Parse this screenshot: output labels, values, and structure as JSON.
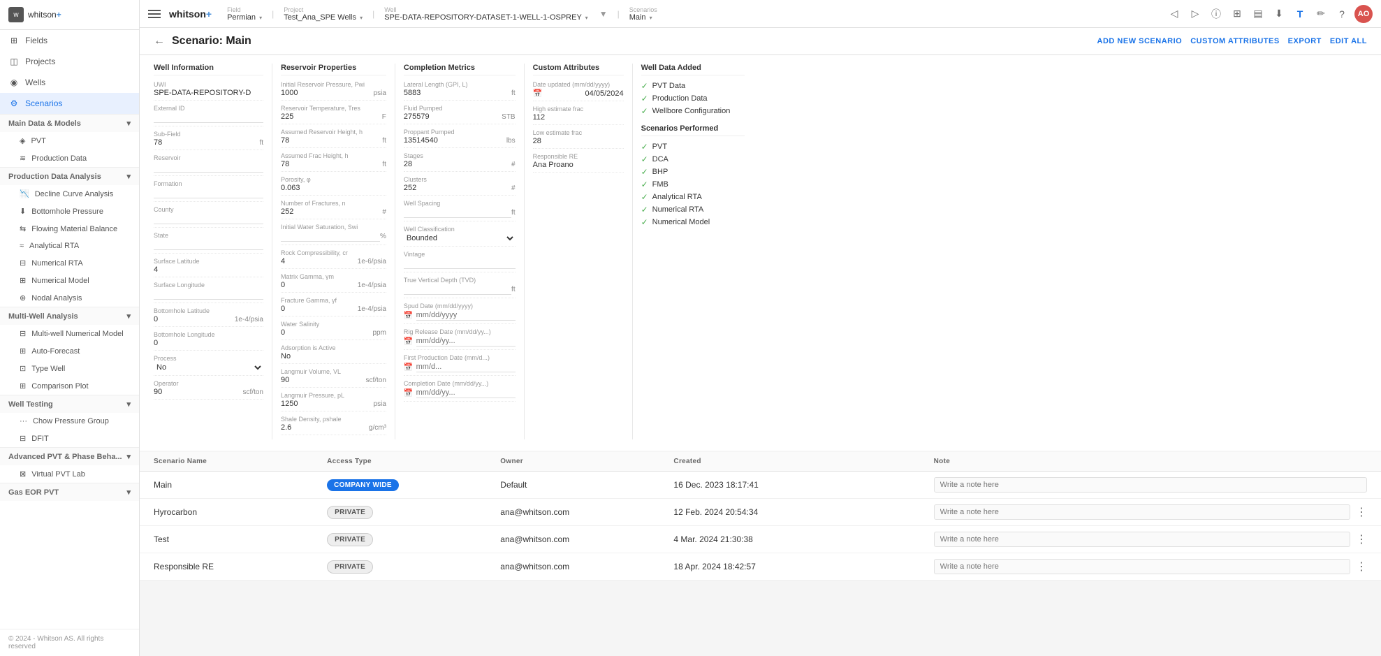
{
  "sidebar": {
    "logo": "whitson",
    "logo_plus": "+",
    "nav": [
      {
        "id": "fields",
        "label": "Fields",
        "icon": "⊞"
      },
      {
        "id": "projects",
        "label": "Projects",
        "icon": "📁"
      },
      {
        "id": "wells",
        "label": "Wells",
        "icon": "◎"
      },
      {
        "id": "scenarios",
        "label": "Scenarios",
        "icon": "⚙",
        "active": true
      }
    ],
    "sections": [
      {
        "id": "main-data",
        "label": "Main Data & Models",
        "expanded": true,
        "items": [
          {
            "id": "pvt",
            "label": "PVT"
          },
          {
            "id": "production-data",
            "label": "Production Data"
          }
        ]
      },
      {
        "id": "production-analysis",
        "label": "Production Data Analysis",
        "expanded": true,
        "items": [
          {
            "id": "decline-curve",
            "label": "Decline Curve Analysis"
          },
          {
            "id": "bottomhole-pressure",
            "label": "Bottomhole Pressure"
          },
          {
            "id": "flowing-material",
            "label": "Flowing Material Balance"
          },
          {
            "id": "analytical-rta",
            "label": "Analytical RTA"
          },
          {
            "id": "numerical-rta",
            "label": "Numerical RTA"
          },
          {
            "id": "numerical-model",
            "label": "Numerical Model"
          },
          {
            "id": "nodal-analysis",
            "label": "Nodal Analysis"
          }
        ]
      },
      {
        "id": "multi-well",
        "label": "Multi-Well Analysis",
        "expanded": true,
        "items": [
          {
            "id": "multi-well-numerical",
            "label": "Multi-well Numerical Model"
          },
          {
            "id": "auto-forecast",
            "label": "Auto-Forecast"
          },
          {
            "id": "type-well",
            "label": "Type Well"
          },
          {
            "id": "comparison-plot",
            "label": "Comparison Plot"
          }
        ]
      },
      {
        "id": "well-testing",
        "label": "Well Testing",
        "expanded": true,
        "items": [
          {
            "id": "chow-pressure",
            "label": "Chow Pressure Group"
          },
          {
            "id": "dfit",
            "label": "DFIT"
          }
        ]
      },
      {
        "id": "advanced-pvt",
        "label": "Advanced PVT & Phase Beha...",
        "expanded": false,
        "items": [
          {
            "id": "virtual-pvt",
            "label": "Virtual PVT Lab"
          }
        ]
      },
      {
        "id": "gas-eor",
        "label": "Gas EOR PVT",
        "expanded": false,
        "items": []
      }
    ],
    "footer": "© 2024 - Whitson AS. All rights reserved"
  },
  "topbar": {
    "field_label": "Field",
    "field_value": "Permian",
    "project_label": "Project",
    "project_value": "Test_Ana_SPE Wells",
    "well_label": "Well",
    "well_value": "SPE-DATA-REPOSITORY-DATASET-1-WELL-1-OSPREY",
    "scenarios_label": "Scenarios",
    "scenarios_value": "Main",
    "filter_icon": "▼"
  },
  "page": {
    "back_label": "←",
    "title": "Scenario: Main",
    "actions": {
      "add_new_scenario": "ADD NEW SCENARIO",
      "custom_attributes": "CUSTOM ATTRIBUTES",
      "export": "EXPORT",
      "edit_all": "EDIT ALL"
    }
  },
  "well_information": {
    "title": "Well Information",
    "fields": [
      {
        "label": "UWI",
        "value": "SPE-DATA-REPOSITORY-D",
        "unit": ""
      },
      {
        "label": "External ID",
        "value": "",
        "unit": ""
      },
      {
        "label": "Sub-Field",
        "value": "78",
        "unit": "ft"
      },
      {
        "label": "Reservoir",
        "value": "",
        "unit": ""
      },
      {
        "label": "Formation",
        "value": "",
        "unit": ""
      },
      {
        "label": "County",
        "value": "",
        "unit": ""
      },
      {
        "label": "State",
        "value": "",
        "unit": ""
      },
      {
        "label": "Surface Latitude",
        "value": "4",
        "unit": ""
      },
      {
        "label": "Surface Longitude",
        "value": "",
        "unit": ""
      },
      {
        "label": "Bottomhole Latitude",
        "value": "0",
        "unit": "1e-4/psia"
      },
      {
        "label": "Bottomhole Longitude",
        "value": "0",
        "unit": ""
      },
      {
        "label": "Process",
        "value": "No",
        "unit": "",
        "type": "select"
      },
      {
        "label": "Operator",
        "value": "90",
        "unit": "scf/ton"
      }
    ]
  },
  "reservoir_properties": {
    "title": "Reservoir Properties",
    "fields": [
      {
        "label": "Initial Reservoir Pressure, Pwi",
        "value": "1000",
        "unit": "psia"
      },
      {
        "label": "Reservoir Temperature, Tres",
        "value": "225",
        "unit": "F"
      },
      {
        "label": "Assumed Reservoir Height, h",
        "value": "78",
        "unit": "ft"
      },
      {
        "label": "Assumed Frac Height, h",
        "value": "78",
        "unit": "ft"
      },
      {
        "label": "Porosity, φ",
        "value": "0.063",
        "unit": ""
      },
      {
        "label": "Number of Fractures, n",
        "value": "252",
        "unit": "#"
      },
      {
        "label": "Initial Water Saturation, Swi",
        "value": "",
        "unit": "%"
      },
      {
        "label": "Rock Compressibility, cr",
        "value": "4",
        "unit": "1e-6/psia"
      },
      {
        "label": "Matrix Gamma, γm",
        "value": "0",
        "unit": "1e-4/psia"
      },
      {
        "label": "Fracture Gamma, γf",
        "value": "0",
        "unit": "1e-4/psia"
      },
      {
        "label": "Water Salinity",
        "value": "0",
        "unit": "ppm"
      },
      {
        "label": "Adsorption is Active",
        "value": "No",
        "unit": ""
      },
      {
        "label": "Langmuir Volume, VL",
        "value": "90",
        "unit": "scf/ton"
      },
      {
        "label": "Langmuir Pressure, pL",
        "value": "1250",
        "unit": "psia"
      },
      {
        "label": "Shale Density, ρshale",
        "value": "2.6",
        "unit": "g/cm³"
      }
    ]
  },
  "completion_metrics": {
    "title": "Completion Metrics",
    "fields": [
      {
        "label": "Lateral Length (GPI, L)",
        "value": "5883",
        "unit": "ft"
      },
      {
        "label": "Fluid Pumped",
        "value": "275579",
        "unit": "STB"
      },
      {
        "label": "Proppant Pumped",
        "value": "13514540",
        "unit": "lbs"
      },
      {
        "label": "Stages",
        "value": "28",
        "unit": "#"
      },
      {
        "label": "Clusters",
        "value": "252",
        "unit": "#"
      },
      {
        "label": "Well Spacing",
        "value": "",
        "unit": "ft"
      },
      {
        "label": "Well Classification",
        "value": "Bounded",
        "unit": "",
        "type": "select"
      },
      {
        "label": "Vintage",
        "value": "",
        "unit": ""
      },
      {
        "label": "True Vertical Depth (TVD)",
        "value": "",
        "unit": "ft"
      },
      {
        "label": "Spud Date (mm/dd/yyyy)",
        "value": "",
        "unit": "",
        "has_cal": true
      },
      {
        "label": "Rig Release Date (mm/dd/yy...)",
        "value": "",
        "unit": "",
        "has_cal": true
      },
      {
        "label": "First Production Date (mm/d...)",
        "value": "",
        "unit": "",
        "has_cal": true
      },
      {
        "label": "Completion Date (mm/dd/yy...)",
        "value": "",
        "unit": "",
        "has_cal": true
      }
    ]
  },
  "custom_attributes": {
    "title": "Custom Attributes",
    "fields": [
      {
        "label": "Date updated (mm/dd/yyyy)",
        "value": "04/05/2024",
        "unit": "",
        "has_cal": true
      },
      {
        "label": "High estimate frac",
        "value": "112",
        "unit": ""
      },
      {
        "label": "Low estimate frac",
        "value": "28",
        "unit": ""
      },
      {
        "label": "Responsible RE",
        "value": "Ana Proano",
        "unit": ""
      }
    ]
  },
  "well_data_added": {
    "title": "Well Data Added",
    "items": [
      {
        "label": "PVT Data",
        "checked": true
      },
      {
        "label": "Production Data",
        "checked": true
      },
      {
        "label": "Wellbore Configuration",
        "checked": true
      }
    ]
  },
  "scenarios_performed": {
    "title": "Scenarios Performed",
    "items": [
      {
        "label": "PVT",
        "checked": true
      },
      {
        "label": "DCA",
        "checked": true
      },
      {
        "label": "BHP",
        "checked": true
      },
      {
        "label": "FMB",
        "checked": true
      },
      {
        "label": "Analytical RTA",
        "checked": true
      },
      {
        "label": "Numerical RTA",
        "checked": true
      },
      {
        "label": "Numerical Model",
        "checked": true
      }
    ]
  },
  "scenarios_table": {
    "columns": [
      "Scenario Name",
      "Access Type",
      "Owner",
      "Created",
      "Note"
    ],
    "rows": [
      {
        "name": "Main",
        "access_type": "COMPANY WIDE",
        "access_badge": "company",
        "owner": "Default",
        "created": "16 Dec. 2023 18:17:41",
        "note_placeholder": "Write a note here",
        "has_more": false
      },
      {
        "name": "Hyrocarbon",
        "access_type": "PRIVATE",
        "access_badge": "private",
        "owner": "ana@whitson.com",
        "created": "12 Feb. 2024 20:54:34",
        "note_placeholder": "Write a note here",
        "has_more": true
      },
      {
        "name": "Test",
        "access_type": "PRIVATE",
        "access_badge": "private",
        "owner": "ana@whitson.com",
        "created": "4 Mar. 2024 21:30:38",
        "note_placeholder": "Write a note here",
        "has_more": true
      },
      {
        "name": "Responsible RE",
        "access_type": "PRIVATE",
        "access_badge": "private",
        "owner": "ana@whitson.com",
        "created": "18 Apr. 2024 18:42:57",
        "note_placeholder": "Write a note here",
        "has_more": true
      }
    ]
  },
  "icons": {
    "back": "←",
    "check": "✓",
    "chevron_down": "▾",
    "chevron_right": "▸",
    "calendar": "📅",
    "more": "⋮",
    "arrow_left": "◁",
    "arrow_right": "▷",
    "info": "ⓘ",
    "grid": "⊞",
    "download": "⬇",
    "text_format": "T",
    "help": "?",
    "settings": "⚙"
  }
}
